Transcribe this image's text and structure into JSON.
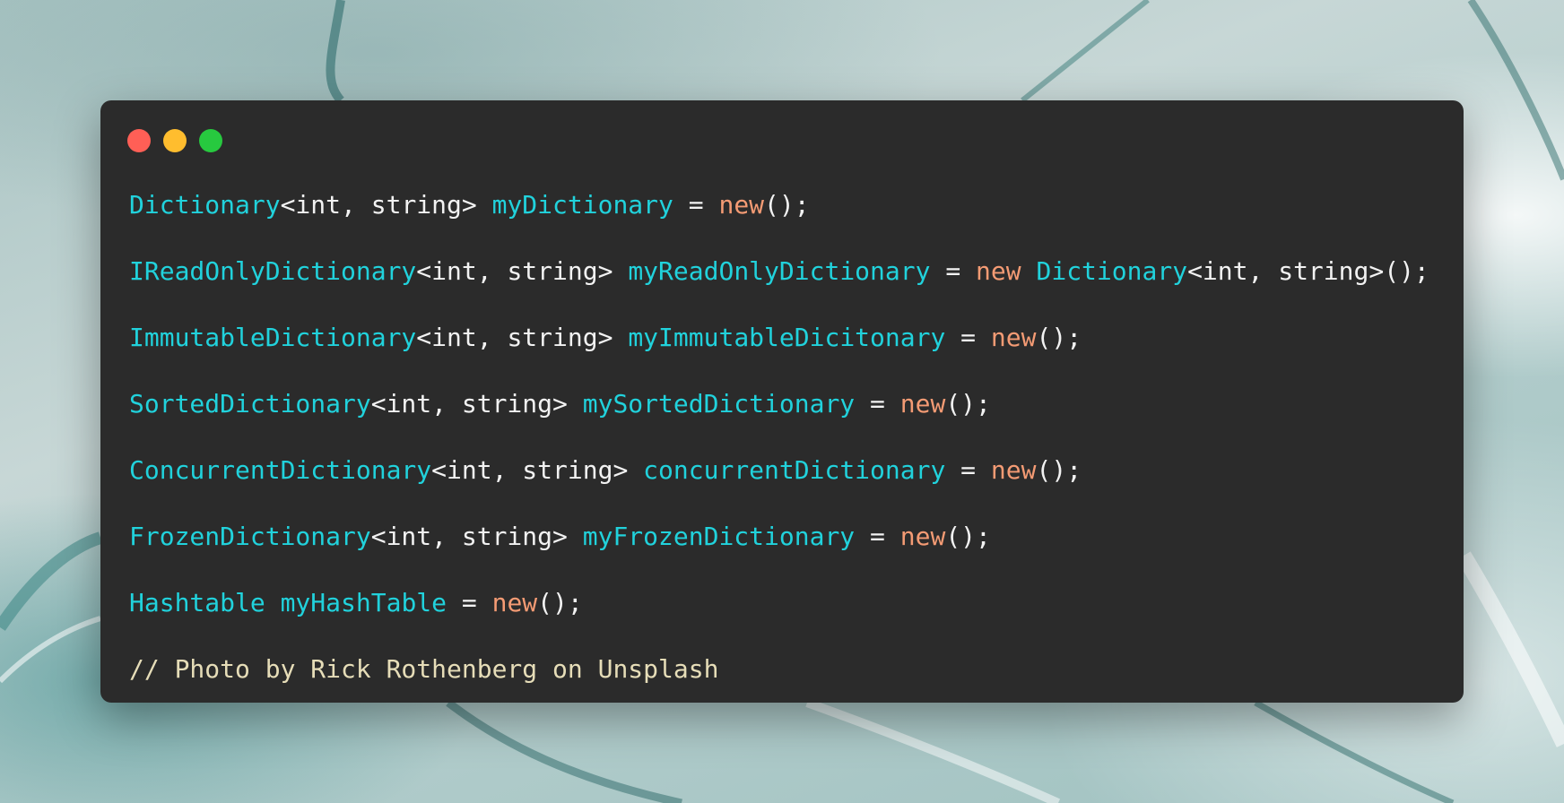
{
  "window": {
    "controls": [
      {
        "name": "close",
        "color": "#ff5f56"
      },
      {
        "name": "minimize",
        "color": "#ffbd2e"
      },
      {
        "name": "maximize",
        "color": "#27c93f"
      }
    ]
  },
  "colors": {
    "background": "#2b2b2b",
    "type": "#21d2dc",
    "keyword": "#f49b74",
    "text": "#f2f2f2",
    "comment": "#e6ddb8"
  },
  "code_lines": [
    [
      {
        "t": "type",
        "v": "Dictionary"
      },
      {
        "t": "punct",
        "v": "<int, string> "
      },
      {
        "t": "var",
        "v": "myDictionary"
      },
      {
        "t": "punct",
        "v": " = "
      },
      {
        "t": "kw",
        "v": "new"
      },
      {
        "t": "punct",
        "v": "();"
      }
    ],
    [
      {
        "t": "type",
        "v": "IReadOnlyDictionary"
      },
      {
        "t": "punct",
        "v": "<int, string> "
      },
      {
        "t": "var",
        "v": "myReadOnlyDictionary"
      },
      {
        "t": "punct",
        "v": " = "
      },
      {
        "t": "kw",
        "v": "new"
      },
      {
        "t": "punct",
        "v": " "
      },
      {
        "t": "type",
        "v": "Dictionary"
      },
      {
        "t": "punct",
        "v": "<int, string>();"
      }
    ],
    [
      {
        "t": "type",
        "v": "ImmutableDictionary"
      },
      {
        "t": "punct",
        "v": "<int, string> "
      },
      {
        "t": "var",
        "v": "myImmutableDicitonary"
      },
      {
        "t": "punct",
        "v": " = "
      },
      {
        "t": "kw",
        "v": "new"
      },
      {
        "t": "punct",
        "v": "();"
      }
    ],
    [
      {
        "t": "type",
        "v": "SortedDictionary"
      },
      {
        "t": "punct",
        "v": "<int, string> "
      },
      {
        "t": "var",
        "v": "mySortedDictionary"
      },
      {
        "t": "punct",
        "v": " = "
      },
      {
        "t": "kw",
        "v": "new"
      },
      {
        "t": "punct",
        "v": "();"
      }
    ],
    [
      {
        "t": "type",
        "v": "ConcurrentDictionary"
      },
      {
        "t": "punct",
        "v": "<int, string> "
      },
      {
        "t": "var",
        "v": "concurrentDictionary"
      },
      {
        "t": "punct",
        "v": " = "
      },
      {
        "t": "kw",
        "v": "new"
      },
      {
        "t": "punct",
        "v": "();"
      }
    ],
    [
      {
        "t": "type",
        "v": "FrozenDictionary"
      },
      {
        "t": "punct",
        "v": "<int, string> "
      },
      {
        "t": "var",
        "v": "myFrozenDictionary"
      },
      {
        "t": "punct",
        "v": " = "
      },
      {
        "t": "kw",
        "v": "new"
      },
      {
        "t": "punct",
        "v": "();"
      }
    ],
    [
      {
        "t": "type",
        "v": "Hashtable"
      },
      {
        "t": "punct",
        "v": " "
      },
      {
        "t": "var",
        "v": "myHashTable"
      },
      {
        "t": "punct",
        "v": " = "
      },
      {
        "t": "kw",
        "v": "new"
      },
      {
        "t": "punct",
        "v": "();"
      }
    ],
    [
      {
        "t": "comment",
        "v": "// Photo by Rick Rothenberg on Unsplash"
      }
    ]
  ]
}
